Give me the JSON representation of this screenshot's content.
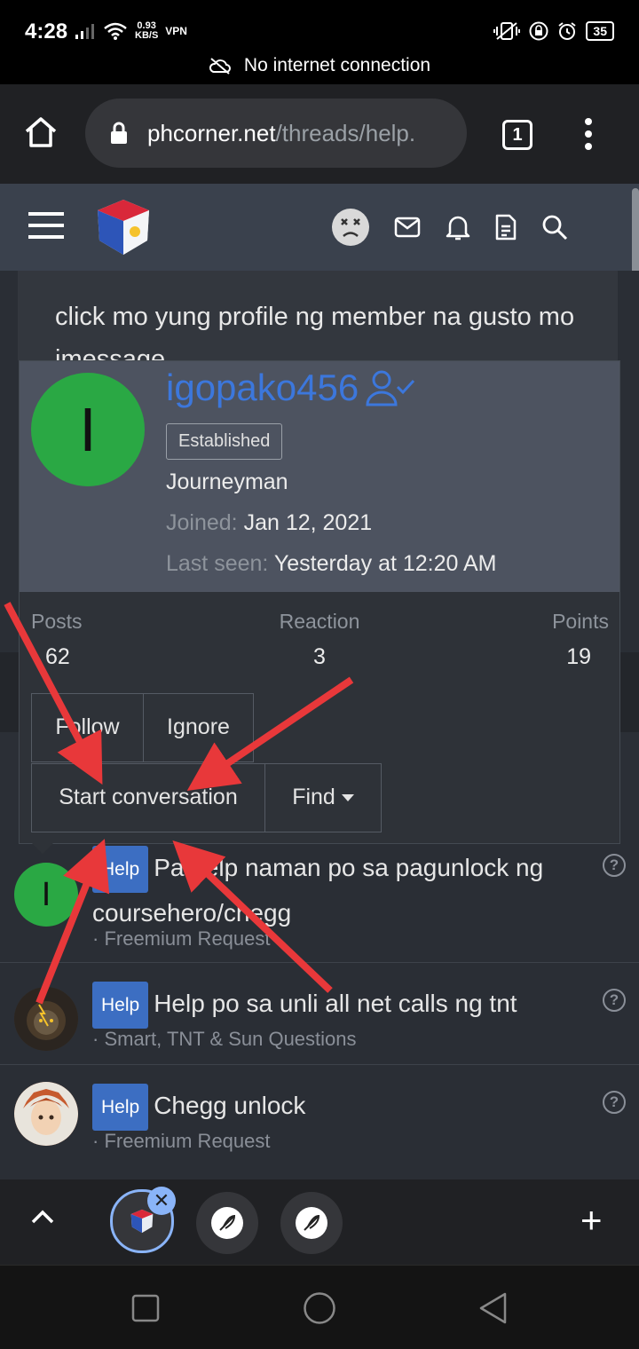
{
  "status_bar": {
    "time": "4:28",
    "speed_value": "0.93",
    "speed_unit": "KB/S",
    "vpn": "VPN",
    "battery": "35",
    "no_internet": "No internet connection"
  },
  "browser": {
    "url_host": "phcorner.net",
    "url_path": "/threads/help.",
    "tab_count": "1"
  },
  "post": {
    "text": "click mo yung profile ng member na gusto mo imessage"
  },
  "member_card": {
    "avatar_letter": "I",
    "username": "igopako456",
    "badge": "Established",
    "user_title": "Journeyman",
    "joined_label": "Joined:",
    "joined_value": "Jan 12, 2021",
    "last_seen_label": "Last seen:",
    "last_seen_value": "Yesterday at 12:20 AM",
    "stats": [
      {
        "label": "Posts",
        "value": "62"
      },
      {
        "label": "Reaction",
        "value": "3"
      },
      {
        "label": "Points",
        "value": "19"
      }
    ],
    "buttons": {
      "follow": "Follow",
      "ignore": "Ignore",
      "start_conversation": "Start conversation",
      "find": "Find"
    }
  },
  "threads": [
    {
      "prefix": "Help",
      "title": "Pa help naman po sa pagunlock ng coursehero/chegg",
      "forum": "· Freemium Request",
      "avatar_letter": "I",
      "avatar_color": "#2aa844"
    },
    {
      "prefix": "Help",
      "title": "Help po sa unli all net calls ng tnt",
      "forum": "· Smart, TNT & Sun Questions",
      "avatar_color": "#3a3226"
    },
    {
      "prefix": "Help",
      "title": "Chegg unlock",
      "forum": "· Freemium Request",
      "avatar_color": "#c9805a"
    }
  ],
  "colors": {
    "accent": "#3c77dc",
    "arrow": "#e8383a",
    "prefix_bg": "#3c6ec2",
    "header_bg": "#3a414d"
  }
}
